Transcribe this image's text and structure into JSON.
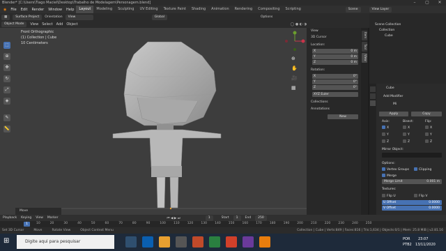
{
  "titlebar": {
    "title": "Blender* [C:\\Users\\Tiago Maciel\\Desktop\\Trabalho de Modelagem\\Personagem.blend]",
    "min": "–",
    "max": "▢",
    "close": "✕"
  },
  "menu": {
    "items": [
      "File",
      "Edit",
      "Render",
      "Window",
      "Help"
    ],
    "workspaces": [
      "Layout",
      "Modeling",
      "Sculpting",
      "UV Editing",
      "Texture Paint",
      "Shading",
      "Animation",
      "Rendering",
      "Compositing",
      "Scripting"
    ],
    "active_workspace": "Layout",
    "scene_label": "Scene",
    "view_layer_label": "View Layer"
  },
  "header": {
    "mode": "Object Mode",
    "view": "View",
    "select": "Select",
    "add": "Add",
    "object": "Object",
    "surface_project": "Surface Project",
    "orientation": "Orientation",
    "view_dropdown": "View",
    "global": "Global",
    "options": "Options"
  },
  "viewport": {
    "line1": "Front Orthographic",
    "line2": "(1) Collection | Cube",
    "line3": "10 Centimeters"
  },
  "npanel": {
    "view_tab": "View",
    "cursor_title": "3D Cursor",
    "location_label": "Location:",
    "loc": [
      {
        "axis": "X",
        "value": "0 m"
      },
      {
        "axis": "Y",
        "value": "0 m"
      },
      {
        "axis": "Z",
        "value": "0 m"
      }
    ],
    "rotation_label": "Rotation:",
    "rot": [
      {
        "axis": "X",
        "value": "0°"
      },
      {
        "axis": "Y",
        "value": "0°"
      },
      {
        "axis": "Z",
        "value": "0°"
      }
    ],
    "rot_mode": "XYZ Euler",
    "collections": "Collections",
    "annotations": "Annotations",
    "new_label": "New",
    "tabs": [
      "Item",
      "Tool",
      "View"
    ]
  },
  "outliner": {
    "root": "Scene Collection",
    "collection": "Collection",
    "object": "Cube"
  },
  "props": {
    "object_name": "Cube",
    "add_modifier": "Add Modifier",
    "modifier_name": "Mi",
    "apply": "Apply",
    "copy": "Copy",
    "axis_label": "Axis:",
    "bisect_label": "Bisect:",
    "flip_label": "Flip:",
    "axes": [
      "X",
      "Y",
      "Z"
    ],
    "mirror_object": "Mirror Object:",
    "options_label": "Options:",
    "vertex_groups": "Vertex Groups",
    "clipping": "Clipping",
    "merge": "Merge",
    "merge_limit_label": "Merge Limit",
    "merge_limit_value": "0.001 m",
    "textures_label": "Textures:",
    "flip_u": "Flip U",
    "flip_v": "Flip V",
    "u_offset_label": "U Offset",
    "u_offset_value": "0.0000",
    "v_offset_label": "V Offset",
    "v_offset_value": "0.0000"
  },
  "timeline": {
    "playback": "Playback",
    "keying": "Keying",
    "view": "View",
    "marker": "Marker",
    "frame_current": "1",
    "start_label": "Start",
    "start_value": "1",
    "end_label": "End",
    "end_value": "250",
    "ticks": [
      "10",
      "20",
      "30",
      "40",
      "50",
      "60",
      "70",
      "80",
      "90",
      "100",
      "110",
      "120",
      "130",
      "140",
      "150",
      "160",
      "170",
      "180",
      "190",
      "200",
      "210",
      "220",
      "230",
      "240",
      "250"
    ]
  },
  "status": {
    "a": "Set 3D Cursor",
    "b": "Move",
    "c": "Rotate View",
    "d": "Object Context Menu",
    "info": "Collection | Cube | Verts:849 | Faces:816 | Tris:1,634 | Objects:0/1 | Mem: 25.8 MiB | v2.81.16"
  },
  "taskbar": {
    "search_placeholder": "Digite aqui para pesquisar",
    "lang": "POR",
    "layout": "PTB2",
    "time": "23:07",
    "date": "13/11/2020"
  },
  "move_panel": "Move"
}
